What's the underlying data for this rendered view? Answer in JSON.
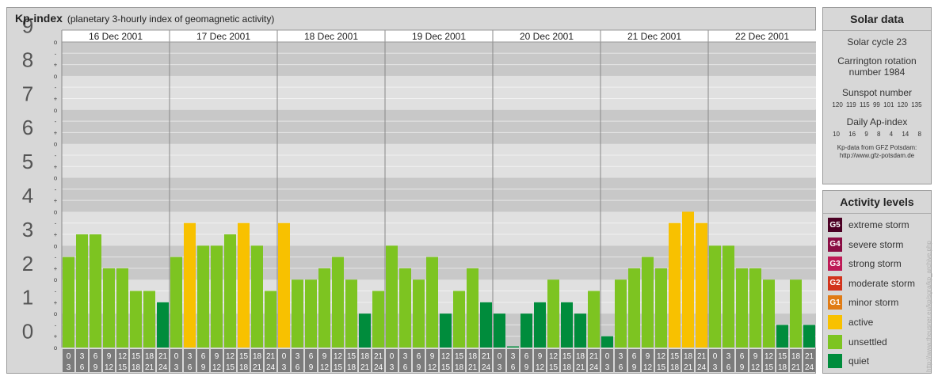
{
  "header": {
    "title": "Kp-index",
    "subtitle": "(planetary 3-hourly index of geomagnetic activity)"
  },
  "chart_data": {
    "type": "bar",
    "ylim": [
      0,
      9
    ],
    "y_ticks": [
      "0",
      "1",
      "2",
      "3",
      "4",
      "5",
      "6",
      "7",
      "8",
      "9"
    ],
    "minor_tick_labels": [
      "+",
      "o",
      "-"
    ],
    "days": [
      "16 Dec 2001",
      "17 Dec 2001",
      "18 Dec 2001",
      "19 Dec 2001",
      "20 Dec 2001",
      "21 Dec 2001",
      "22 Dec 2001"
    ],
    "interval_labels": [
      [
        "0",
        "3"
      ],
      [
        "3",
        "6"
      ],
      [
        "6",
        "9"
      ],
      [
        "9",
        "12"
      ],
      [
        "12",
        "15"
      ],
      [
        "15",
        "18"
      ],
      [
        "18",
        "21"
      ],
      [
        "21",
        "24"
      ]
    ],
    "values": [
      [
        2.667,
        3.333,
        3.333,
        2.333,
        2.333,
        1.667,
        1.667,
        1.333
      ],
      [
        2.667,
        3.667,
        3.0,
        3.0,
        3.333,
        3.667,
        3.0,
        1.667
      ],
      [
        3.667,
        2.0,
        2.0,
        2.333,
        2.667,
        2.0,
        1.0,
        1.667
      ],
      [
        3.0,
        2.333,
        2.0,
        2.667,
        1.0,
        1.667,
        2.333,
        1.333
      ],
      [
        1.0,
        0.0,
        1.0,
        1.333,
        2.0,
        1.333,
        1.0,
        1.667
      ],
      [
        0.333,
        2.0,
        2.333,
        2.667,
        2.333,
        3.667,
        4.0,
        3.667
      ],
      [
        3.0,
        3.0,
        2.333,
        2.333,
        2.0,
        0.667,
        2.0,
        0.667
      ]
    ],
    "colors": {
      "quiet": "#008c3c",
      "unsettled": "#7dc421",
      "active": "#f8c100",
      "minor_storm": "#e07b14",
      "moderate_storm": "#d2331c",
      "strong_storm": "#be1a56",
      "severe_storm": "#8a0d44",
      "extreme_storm": "#4b0024"
    }
  },
  "solar": {
    "title": "Solar data",
    "cycle": "Solar cycle 23",
    "carrington_line1": "Carrington rotation",
    "carrington_line2": "number 1984",
    "sunspot_title": "Sunspot number",
    "sunspot_values": "120 119 115 99 101 120 135",
    "ap_title": "Daily Ap-index",
    "ap_values": "10 16 9 8 4 14 8",
    "source_line1": "Kp-data from GFZ Potsdam:",
    "source_line2": "http://www.gfz-potsdam.de"
  },
  "levels": {
    "title": "Activity levels",
    "items": [
      {
        "badge": "G5",
        "label": "extreme storm",
        "color": "#4b0024"
      },
      {
        "badge": "G4",
        "label": "severe storm",
        "color": "#8a0d44"
      },
      {
        "badge": "G3",
        "label": "strong storm",
        "color": "#be1a56"
      },
      {
        "badge": "G2",
        "label": "moderate storm",
        "color": "#d2331c"
      },
      {
        "badge": "G1",
        "label": "minor storm",
        "color": "#e07b14"
      },
      {
        "badge": "",
        "label": "active",
        "color": "#f8c100"
      },
      {
        "badge": "",
        "label": "unsettled",
        "color": "#7dc421"
      },
      {
        "badge": "",
        "label": "quiet",
        "color": "#008c3c"
      }
    ]
  },
  "watermark": "http://www.theusner.eu/kp/sgra/kp_archive.php"
}
